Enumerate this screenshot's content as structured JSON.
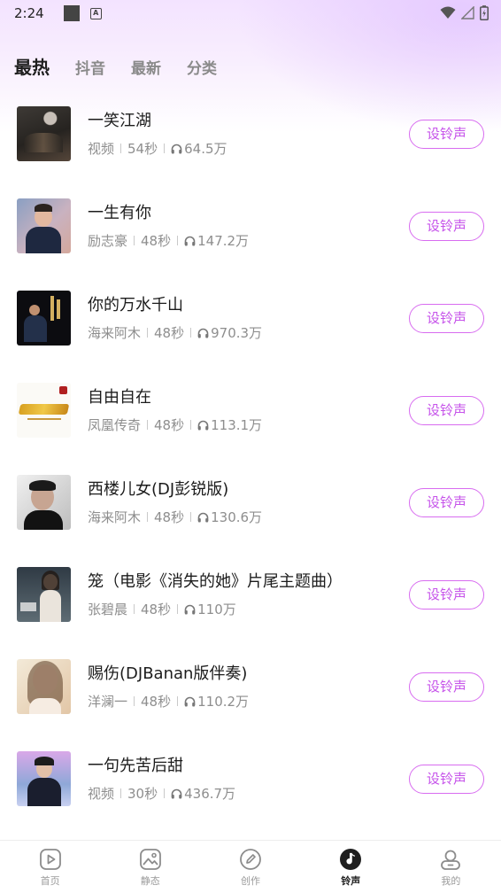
{
  "status_bar": {
    "time": "2:24"
  },
  "tabs": [
    {
      "label": "最热",
      "active": true
    },
    {
      "label": "抖音",
      "active": false
    },
    {
      "label": "最新",
      "active": false
    },
    {
      "label": "分类",
      "active": false
    }
  ],
  "accent_color": "#c653ea",
  "ringtones": [
    {
      "title": "一笑江湖",
      "artist": "视频",
      "duration": "54秒",
      "plays": "64.5万",
      "button": "设铃声"
    },
    {
      "title": "一生有你",
      "artist": "励志豪",
      "duration": "48秒",
      "plays": "147.2万",
      "button": "设铃声"
    },
    {
      "title": "你的万水千山",
      "artist": "海来阿木",
      "duration": "48秒",
      "plays": "970.3万",
      "button": "设铃声"
    },
    {
      "title": "自由自在",
      "artist": "凤凰传奇",
      "duration": "48秒",
      "plays": "113.1万",
      "button": "设铃声"
    },
    {
      "title": "西楼儿女(DJ彭锐版)",
      "artist": "海来阿木",
      "duration": "48秒",
      "plays": "130.6万",
      "button": "设铃声"
    },
    {
      "title": "笼（电影《消失的她》片尾主题曲）",
      "artist": "张碧晨",
      "duration": "48秒",
      "plays": "110万",
      "button": "设铃声"
    },
    {
      "title": "赐伤(DJBanan版伴奏)",
      "artist": "洋澜一",
      "duration": "48秒",
      "plays": "110.2万",
      "button": "设铃声"
    },
    {
      "title": "一句先苦后甜",
      "artist": "视频",
      "duration": "30秒",
      "plays": "436.7万",
      "button": "设铃声"
    }
  ],
  "bottom_nav": [
    {
      "label": "首页",
      "icon": "play-square-icon",
      "active": false
    },
    {
      "label": "静态",
      "icon": "image-icon",
      "active": false
    },
    {
      "label": "创作",
      "icon": "pencil-icon",
      "active": false
    },
    {
      "label": "铃声",
      "icon": "music-note-icon",
      "active": true
    },
    {
      "label": "我的",
      "icon": "user-icon",
      "active": false
    }
  ]
}
